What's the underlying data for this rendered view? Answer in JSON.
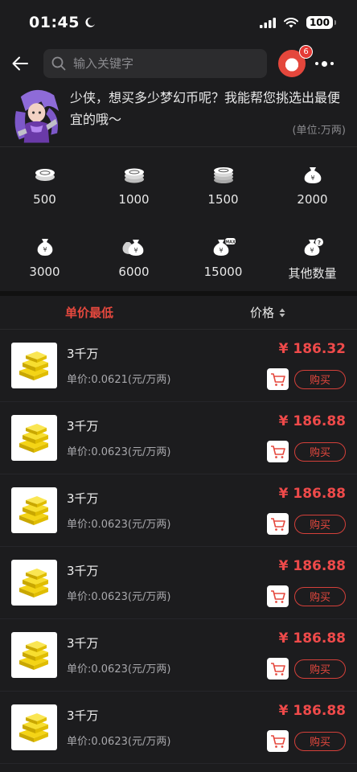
{
  "status_bar": {
    "time": "01:45",
    "battery": "100"
  },
  "nav": {
    "search_placeholder": "输入关键字",
    "notification_count": "6"
  },
  "intro": {
    "message": "少侠，想买多少梦幻币呢？我能帮您挑选出最便宜的哦～",
    "unit_note": "(单位:万两)"
  },
  "quantities": [
    {
      "label": "500",
      "icon": "coin-stack-icon"
    },
    {
      "label": "1000",
      "icon": "coin-stack-icon"
    },
    {
      "label": "1500",
      "icon": "coin-stack-icon"
    },
    {
      "label": "2000",
      "icon": "money-bag-icon"
    },
    {
      "label": "3000",
      "icon": "money-bag-icon"
    },
    {
      "label": "6000",
      "icon": "money-bags-icon"
    },
    {
      "label": "15000",
      "icon": "money-bag-max-icon"
    },
    {
      "label": "其他数量",
      "icon": "money-bag-question-icon"
    }
  ],
  "sort": {
    "lowest_unit_price": "单价最低",
    "price": "价格"
  },
  "colors": {
    "accent": "#e5483e",
    "background": "#1c1c1e"
  },
  "listings": [
    {
      "title": "3千万",
      "unit_price": "单价:0.0621(元/万两)",
      "price": "¥ 186.32",
      "buy": "购买"
    },
    {
      "title": "3千万",
      "unit_price": "单价:0.0623(元/万两)",
      "price": "¥ 186.88",
      "buy": "购买"
    },
    {
      "title": "3千万",
      "unit_price": "单价:0.0623(元/万两)",
      "price": "¥ 186.88",
      "buy": "购买"
    },
    {
      "title": "3千万",
      "unit_price": "单价:0.0623(元/万两)",
      "price": "¥ 186.88",
      "buy": "购买"
    },
    {
      "title": "3千万",
      "unit_price": "单价:0.0623(元/万两)",
      "price": "¥ 186.88",
      "buy": "购买"
    },
    {
      "title": "3千万",
      "unit_price": "单价:0.0623(元/万两)",
      "price": "¥ 186.88",
      "buy": "购买"
    }
  ]
}
